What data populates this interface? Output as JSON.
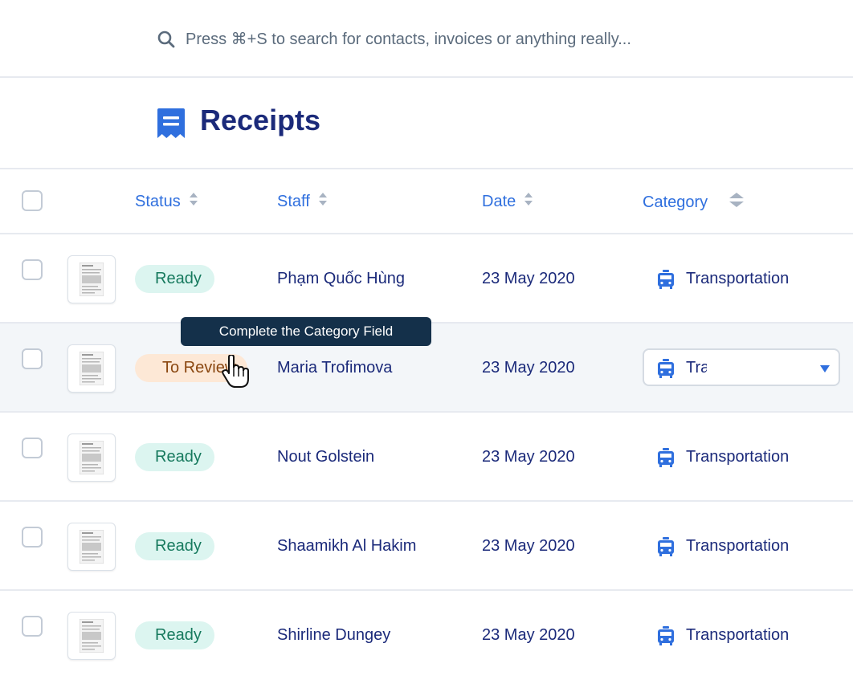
{
  "search": {
    "placeholder": "Press ⌘+S to search for contacts, invoices or anything really..."
  },
  "page": {
    "title": "Receipts",
    "title_icon": "receipt-icon"
  },
  "table": {
    "columns": [
      {
        "label": "Status",
        "sortable": true
      },
      {
        "label": "Staff",
        "sortable": true
      },
      {
        "label": "Date",
        "sortable": true
      },
      {
        "label": "Category",
        "sortable": true
      }
    ],
    "rows": [
      {
        "status": "Ready",
        "status_type": "ready",
        "staff": "Phạm Quốc Hùng",
        "date": "23 May 2020",
        "category": "Transportation",
        "category_icon": "tram-icon"
      },
      {
        "status": "To Review",
        "status_type": "review",
        "staff": "Maria Trofimova",
        "date": "23 May 2020",
        "category": "Transportation",
        "category_icon": "tram-icon",
        "editing": true
      },
      {
        "status": "Ready",
        "status_type": "ready",
        "staff": "Nout Golstein",
        "date": "23 May 2020",
        "category": "Transportation",
        "category_icon": "tram-icon"
      },
      {
        "status": "Ready",
        "status_type": "ready",
        "staff": "Shaamikh Al Hakim",
        "date": "23 May 2020",
        "category": "Transportation",
        "category_icon": "tram-icon"
      },
      {
        "status": "Ready",
        "status_type": "ready",
        "staff": "Shirline Dungey",
        "date": "23 May 2020",
        "category": "Transportation",
        "category_icon": "tram-icon"
      }
    ]
  },
  "tooltip": {
    "text": "Complete the Category Field"
  },
  "colors": {
    "accent": "#2f6fde",
    "title": "#1b2a7a",
    "ready_bg": "#dcf5f0",
    "ready_text": "#177a5e",
    "review_bg": "#fde8d6",
    "review_text": "#8a4710",
    "tooltip_bg": "#14304a"
  }
}
